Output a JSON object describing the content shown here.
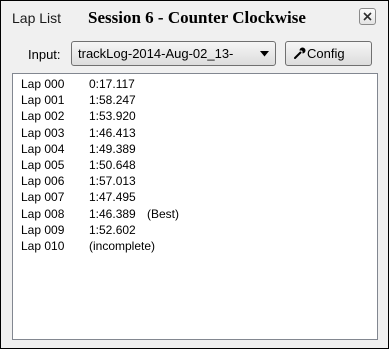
{
  "window": {
    "app_title": "Lap List",
    "session_title": "Session 6 - Counter Clockwise",
    "close_icon": "close-icon"
  },
  "toolbar": {
    "input_label": "Input:",
    "input_value": "trackLog-2014-Aug-02_13-",
    "input_arrow_icon": "chevron-down-icon",
    "config_label": "Config",
    "config_icon": "wrench-icon"
  },
  "laps": [
    {
      "label": "Lap 000",
      "time": "0:17.117",
      "note": ""
    },
    {
      "label": "Lap 001",
      "time": "1:58.247",
      "note": ""
    },
    {
      "label": "Lap 002",
      "time": "1:53.920",
      "note": ""
    },
    {
      "label": "Lap 003",
      "time": "1:46.413",
      "note": ""
    },
    {
      "label": "Lap 004",
      "time": "1:49.389",
      "note": ""
    },
    {
      "label": "Lap 005",
      "time": "1:50.648",
      "note": ""
    },
    {
      "label": "Lap 006",
      "time": "1:57.013",
      "note": ""
    },
    {
      "label": "Lap 007",
      "time": "1:47.495",
      "note": ""
    },
    {
      "label": "Lap 008",
      "time": "1:46.389",
      "note": "(Best)"
    },
    {
      "label": "Lap 009",
      "time": "1:52.602",
      "note": ""
    },
    {
      "label": "Lap 010",
      "time": "(incomplete)",
      "note": ""
    }
  ]
}
